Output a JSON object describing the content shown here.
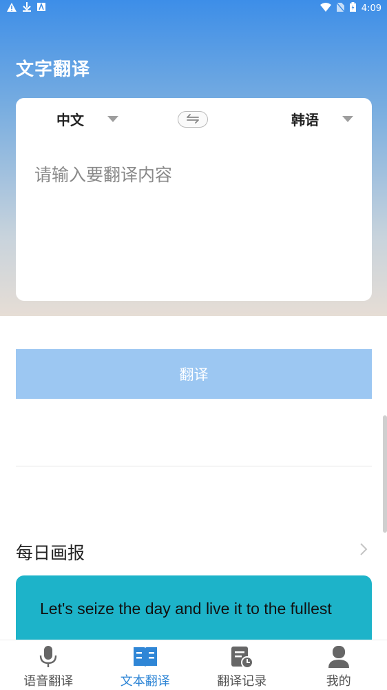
{
  "status": {
    "time": "4:09"
  },
  "header": {
    "title": "文字翻译"
  },
  "translator": {
    "source_lang": "中文",
    "target_lang": "韩语",
    "input_placeholder": "请输入要翻译内容",
    "translate_button": "翻译"
  },
  "daily": {
    "title": "每日画报",
    "quote": "Let's seize the day and live it to the fullest"
  },
  "tabs": [
    {
      "label": "语音翻译",
      "icon": "microphone-icon",
      "active": false
    },
    {
      "label": "文本翻译",
      "icon": "book-icon",
      "active": true
    },
    {
      "label": "翻译记录",
      "icon": "history-icon",
      "active": false
    },
    {
      "label": "我的",
      "icon": "person-icon",
      "active": false
    }
  ],
  "colors": {
    "accent": "#2f86d6",
    "button": "#9cc7f2",
    "daily_card": "#1db3c9"
  }
}
